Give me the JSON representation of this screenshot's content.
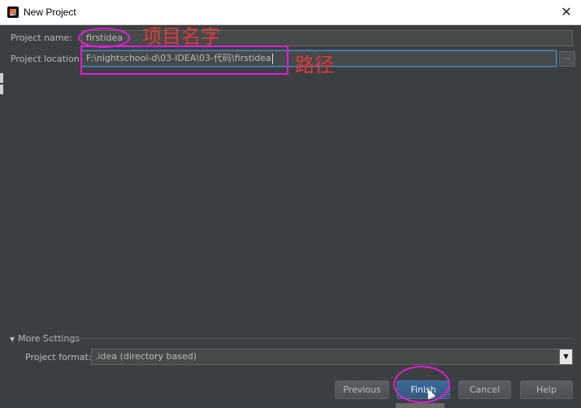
{
  "window": {
    "title": "New Project",
    "close_label": "✕"
  },
  "form": {
    "name_label": "Project name:",
    "name_value": "firstidea",
    "location_label": "Project location:",
    "location_value": "F:\\nightschool-d\\03-IDEA\\03-代码\\firstidea",
    "browse_label": "..."
  },
  "annotations": {
    "name_note": "项目名字",
    "path_note": "路径",
    "color": "#e01fd8",
    "text_color": "#e23a3a"
  },
  "more_settings": {
    "toggle_label": "More Settings",
    "format_label": "Project format:",
    "format_value": ".idea (directory based)"
  },
  "buttons": {
    "previous": "Previous",
    "finish": "Finish",
    "cancel": "Cancel",
    "help": "Help"
  },
  "colors": {
    "background": "#3c3f41",
    "primary_button": "#365880",
    "focus_border": "#4a88c7"
  }
}
